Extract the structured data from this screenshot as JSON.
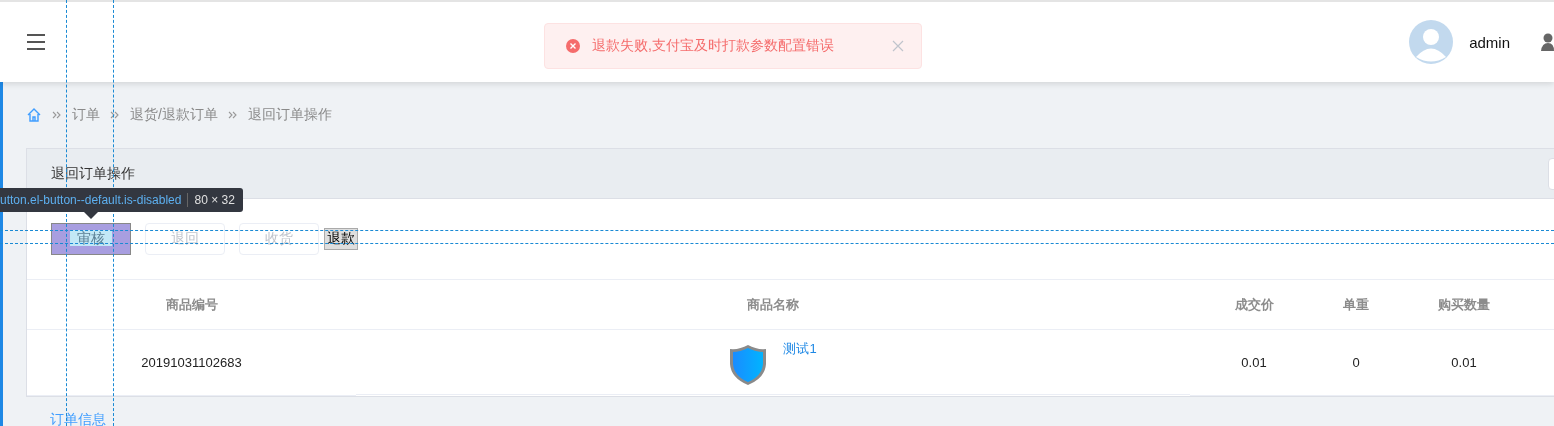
{
  "header": {
    "user": {
      "name": "admin"
    }
  },
  "alert": {
    "kind": "error",
    "message": "退款失败,支付宝及时打款参数配置错误",
    "closable": true
  },
  "breadcrumb": [
    "订单",
    "退货/退款订单",
    "退回订单操作"
  ],
  "card": {
    "title": "退回订单操作",
    "actions": [
      {
        "label": "审核",
        "kind": "element",
        "disabled": true,
        "inspected": true
      },
      {
        "label": "退回",
        "kind": "element",
        "disabled": true,
        "inspected": false
      },
      {
        "label": "收货",
        "kind": "element",
        "disabled": true,
        "inspected": false
      },
      {
        "label": "退款",
        "kind": "native",
        "disabled": false,
        "inspected": false
      }
    ],
    "table": {
      "columns": [
        "商品编号",
        "商品名称",
        "成交价",
        "单重",
        "购买数量"
      ],
      "rows": [
        {
          "code": "20191031102683",
          "name": "测试1",
          "price": "0.01",
          "weight": "0",
          "quantity": "0.01"
        }
      ]
    },
    "section_title": "订单信息"
  },
  "inspector": {
    "selector": "utton.el-button--default.is-disabled",
    "size": "80 × 32"
  }
}
